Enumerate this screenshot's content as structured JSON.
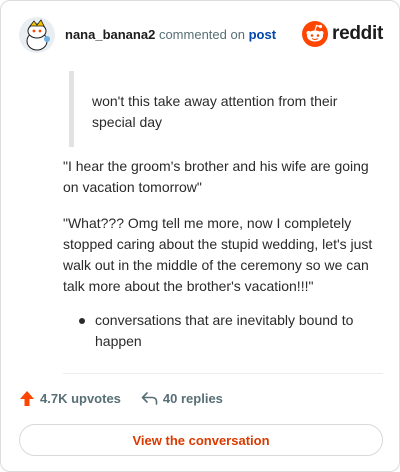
{
  "header": {
    "username": "nana_banana2",
    "commented_text": "commented on",
    "post_link": "post",
    "brand": "reddit"
  },
  "quote": {
    "text": "won't this take away attention from their special day"
  },
  "body": {
    "paragraph1": "\"I hear the groom's brother and his wife are going on vacation tomorrow\"",
    "paragraph2": "\"What??? Omg tell me more, now I completely stopped caring about the stupid wedding, let's just walk out in the middle of the ceremony so we can talk more about the brother's vacation!!!\"",
    "bullets": [
      "conversations that are inevitably bound to happen"
    ]
  },
  "actions": {
    "upvotes": "4.7K upvotes",
    "replies": "40 replies"
  },
  "cta": {
    "label": "View the conversation"
  },
  "colors": {
    "upvote": "#ff4500",
    "brand": "#ff4500",
    "link": "#0045ac",
    "cta_text": "#d93a00"
  },
  "icons": {
    "avatar": "snoo-avatar-icon",
    "brand": "reddit-logo-icon",
    "upvote": "upvote-arrow-icon",
    "reply": "reply-arrow-icon"
  }
}
